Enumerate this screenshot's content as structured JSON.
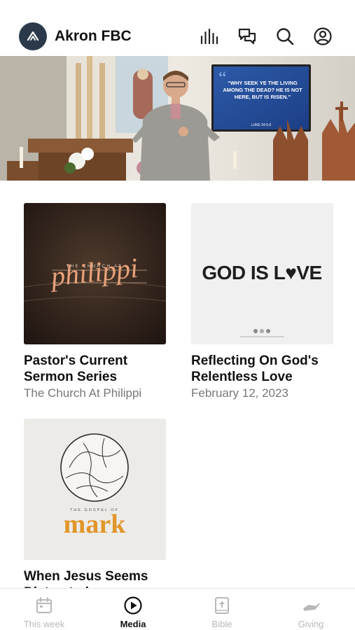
{
  "header": {
    "title": "Akron FBC",
    "icons": [
      "bars-icon",
      "chat-icon",
      "search-icon",
      "profile-icon"
    ]
  },
  "hero": {
    "screen_text": "“WHY SEEK YE THE LIVING AMONG THE DEAD? HE IS NOT HERE, BUT IS RISEN.”",
    "screen_ref": "LUKE 24:5-6"
  },
  "cards": [
    {
      "title": "Pastor's Current Sermon Series",
      "subtitle": "The Church At Philippi",
      "art_small": "THE CHURCH AT",
      "art_big": "philippi"
    },
    {
      "title": "Reflecting On God's Relentless Love",
      "subtitle": "February 12, 2023",
      "art_big": "GOD IS L♥VE"
    },
    {
      "title": "When Jesus Seems Distracted",
      "subtitle": "",
      "art_small": "THE GOSPEL OF",
      "art_big": "mark"
    }
  ],
  "tabs": [
    {
      "label": "This week",
      "icon": "calendar-icon"
    },
    {
      "label": "Media",
      "icon": "play-icon"
    },
    {
      "label": "Bible",
      "icon": "bible-icon"
    },
    {
      "label": "Giving",
      "icon": "giving-icon"
    }
  ],
  "active_tab": "Media",
  "colors": {
    "logo_bg": "#2b3a4a",
    "active": "#111111",
    "inactive": "#b8b8b8",
    "mark_orange": "#e0962a",
    "love_pink": "#d66a86"
  }
}
